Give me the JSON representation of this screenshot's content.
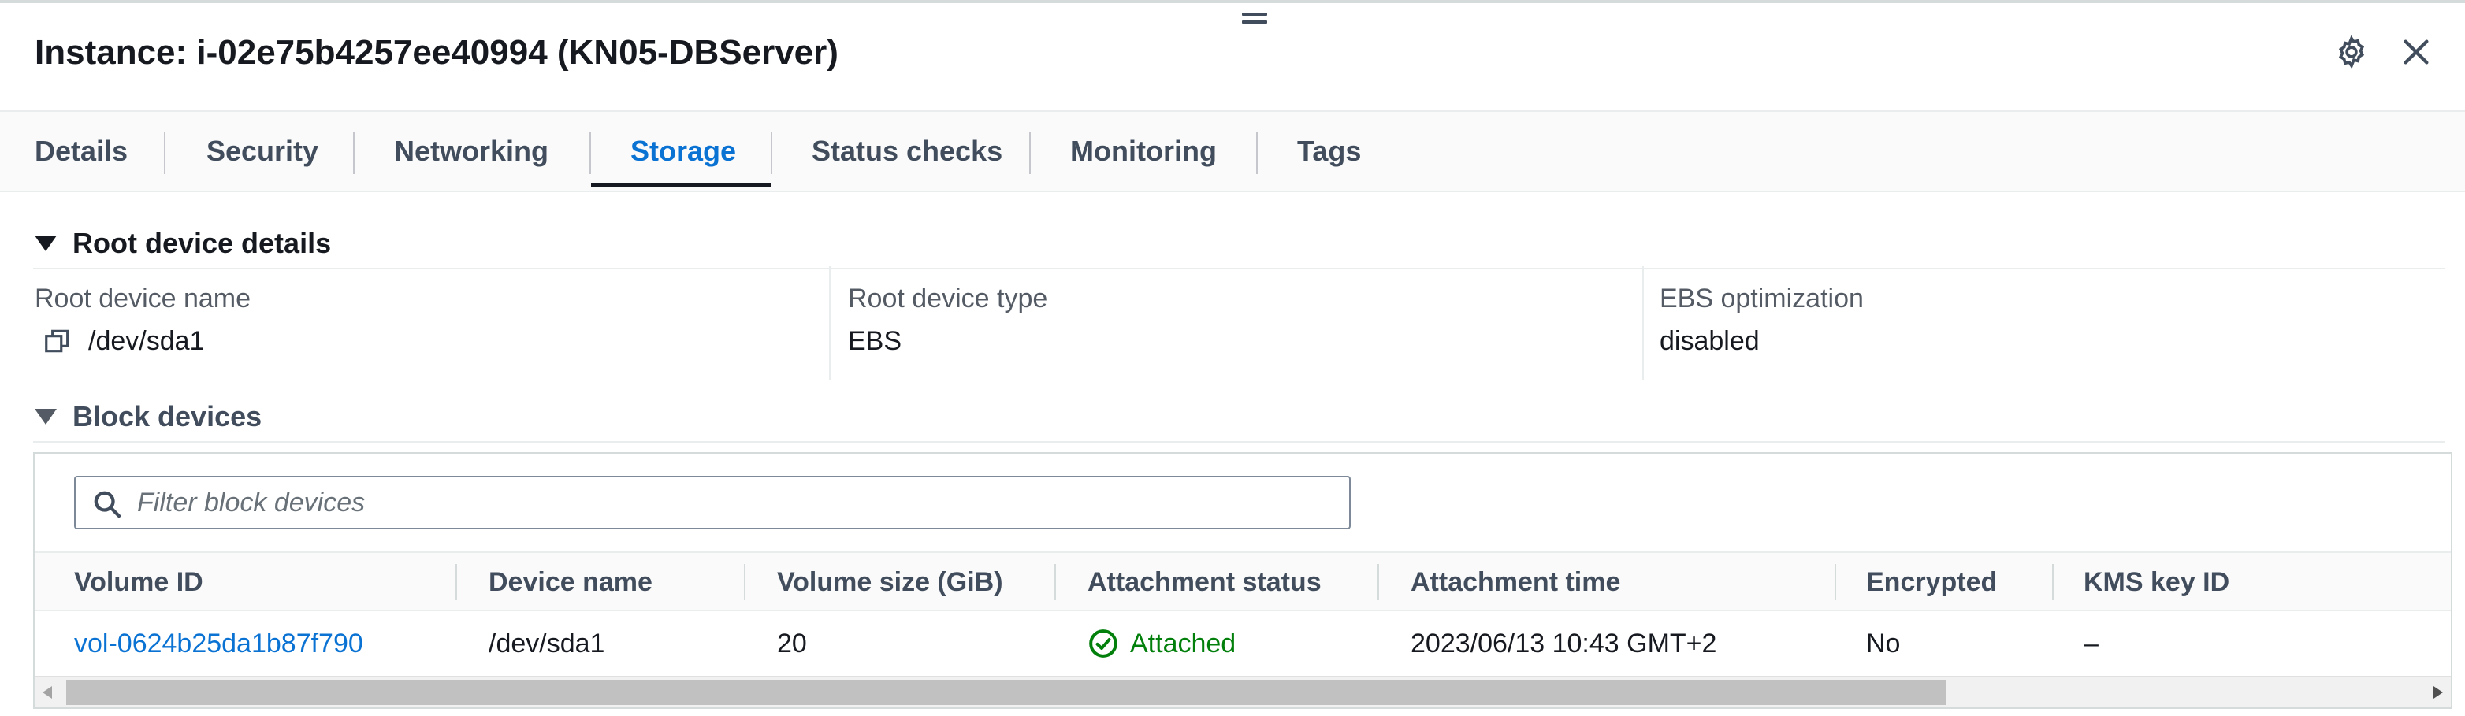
{
  "header": {
    "title": "Instance: i-02e75b4257ee40994 (KN05-DBServer)",
    "settings_icon": "gear-icon",
    "close_icon": "close-icon"
  },
  "tabs": [
    {
      "label": "Details",
      "active": false
    },
    {
      "label": "Security",
      "active": false
    },
    {
      "label": "Networking",
      "active": false
    },
    {
      "label": "Storage",
      "active": true
    },
    {
      "label": "Status checks",
      "active": false
    },
    {
      "label": "Monitoring",
      "active": false
    },
    {
      "label": "Tags",
      "active": false
    }
  ],
  "root_device": {
    "section_title": "Root device details",
    "fields": [
      {
        "label": "Root device name",
        "value": "/dev/sda1",
        "icon": "copy-icon"
      },
      {
        "label": "Root device type",
        "value": "EBS"
      },
      {
        "label": "EBS optimization",
        "value": "disabled"
      }
    ]
  },
  "block_devices": {
    "section_title": "Block devices",
    "filter_placeholder": "Filter block devices",
    "filter_value": "",
    "columns": [
      "Volume ID",
      "Device name",
      "Volume size (GiB)",
      "Attachment status",
      "Attachment time",
      "Encrypted",
      "KMS key ID"
    ],
    "rows": [
      {
        "volume_id": "vol-0624b25da1b87f790",
        "device_name": "/dev/sda1",
        "volume_size": "20",
        "attachment_status": "Attached",
        "attachment_time": "2023/06/13 10:43 GMT+2",
        "encrypted": "No",
        "kms_key_id": "–"
      }
    ]
  },
  "colors": {
    "accent_blue": "#0972d3",
    "success_green": "#037f0c",
    "text_primary": "#16191f",
    "text_secondary": "#545b64"
  }
}
